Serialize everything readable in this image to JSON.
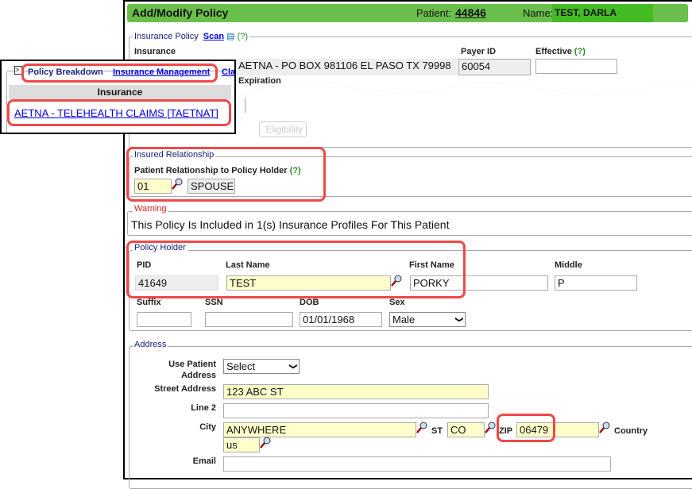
{
  "header": {
    "title": "Add/Modify Policy",
    "patient_label": "Patient:",
    "patient_id": "44846",
    "name_label": "Name:",
    "name": "TEST, DARLA",
    "color": "#6abf4b"
  },
  "insurance_policy": {
    "legend": "Insurance Policy",
    "scan": "Scan",
    "help": "(?)",
    "insurance_label": "Insurance",
    "insurance_value": "AETNA - PO BOX 981106 EL PASO TX 79998",
    "payer_id_label": "Payer ID",
    "payer_id": "60054",
    "effective_label": "Effective",
    "effective_help": "(?)",
    "effective_value": "",
    "expiration_label": "Expiration",
    "eligibility_button": "Eligibility"
  },
  "popup": {
    "policy_breakdown": "Policy Breakdown",
    "insurance_management": "Insurance Management",
    "claims": "Claims",
    "column_header": "Insurance",
    "row_link": "AETNA - TELEHEALTH CLAIMS [TAETNAT]"
  },
  "insured_relationship": {
    "legend": "Insured Relationship",
    "label": "Patient Relationship to Policy Holder",
    "help": "(?)",
    "code": "01",
    "description": "SPOUSE"
  },
  "warning": {
    "legend": "Warning",
    "text": "This Policy Is Included in 1(s) Insurance Profiles For This Patient"
  },
  "policy_holder": {
    "legend": "Policy Holder",
    "pid_label": "PID",
    "pid": "41649",
    "last_label": "Last Name",
    "last": "TEST",
    "first_label": "First Name",
    "first": "PORKY",
    "middle_label": "Middle",
    "middle": "P",
    "suffix_label": "Suffix",
    "suffix": "",
    "ssn_label": "SSN",
    "ssn": "",
    "dob_label": "DOB",
    "dob": "01/01/1968",
    "sex_label": "Sex",
    "sex": "Male"
  },
  "address": {
    "legend": "Address",
    "use_patient_label1": "Use Patient",
    "use_patient_label2": "Address",
    "use_patient_value": "Select",
    "street_label": "Street Address",
    "street": "123 ABC ST",
    "line2_label": "Line 2",
    "line2": "",
    "city_label": "City",
    "city": "ANYWHERE",
    "st_label": "ST",
    "st": "CO",
    "zip_label": "ZIP",
    "zip": "06479",
    "country_label": "Country",
    "country": "us",
    "email_label": "Email",
    "email": ""
  },
  "colors": {
    "highlight": "#f04848",
    "required_field": "#ffffcc",
    "name_bg": "#44bb22"
  }
}
